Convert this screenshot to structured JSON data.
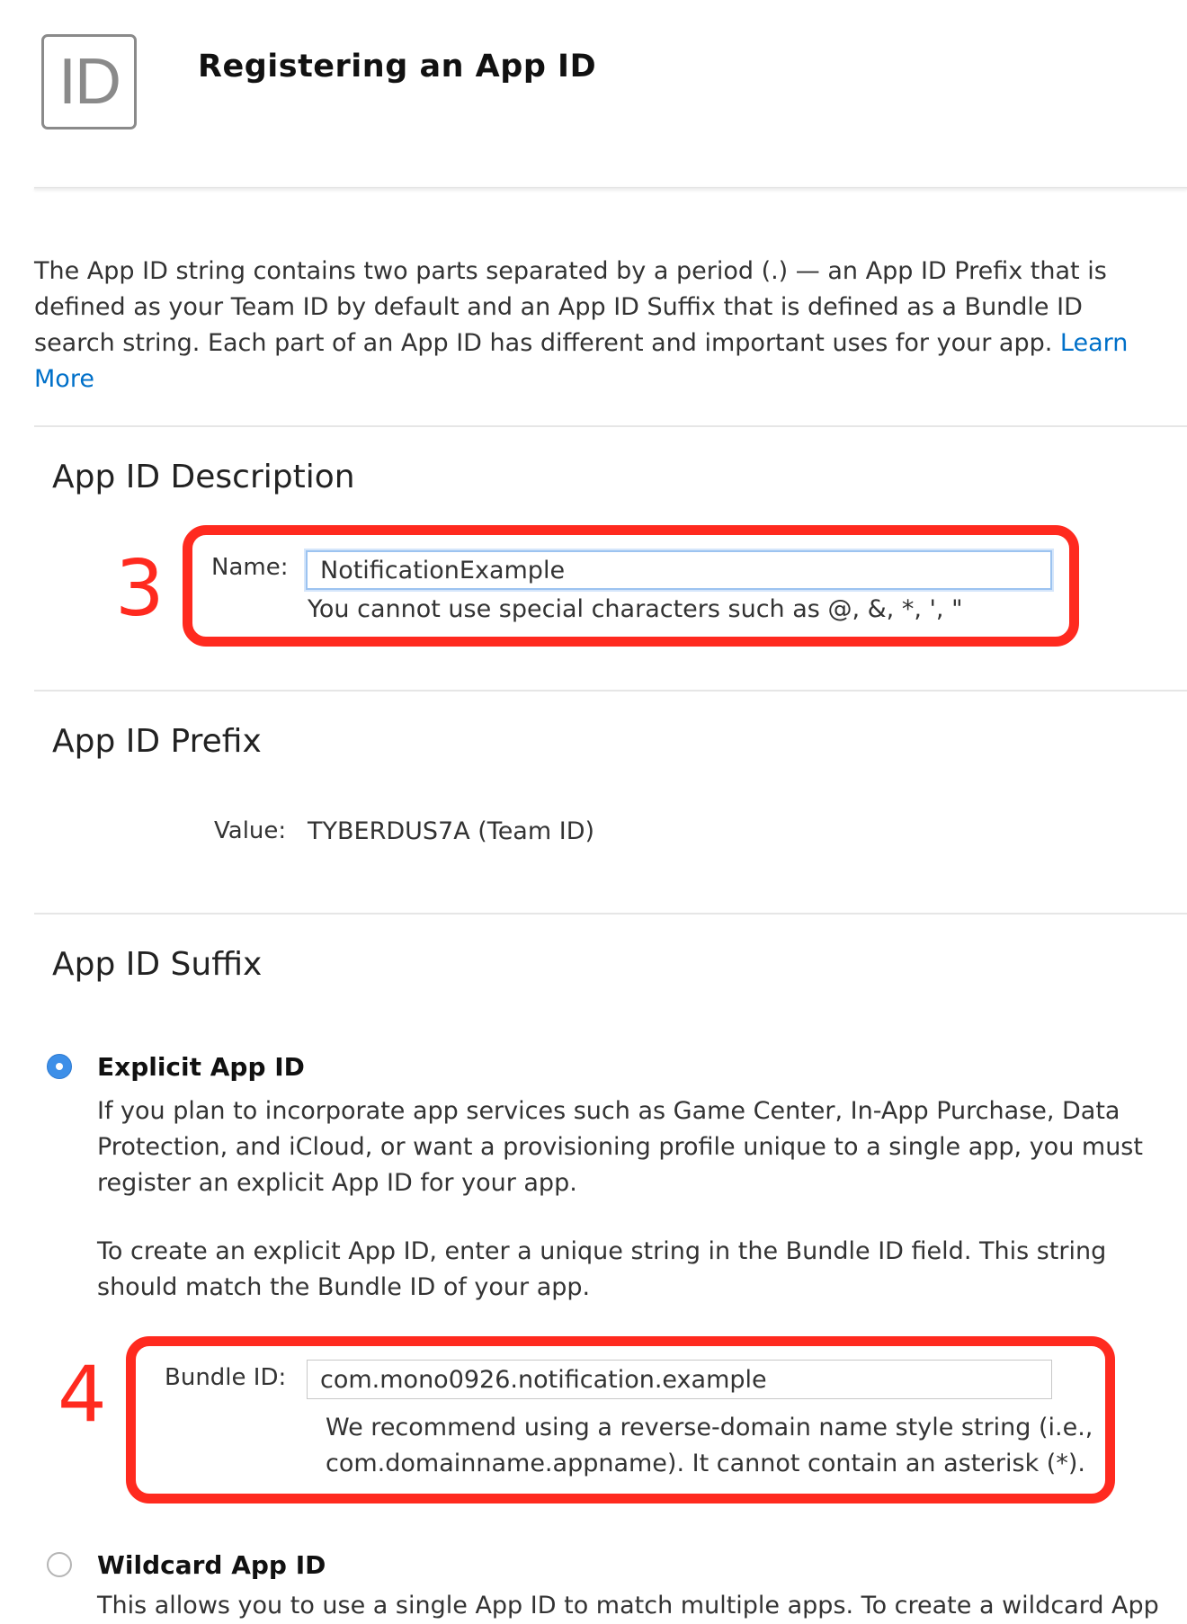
{
  "header": {
    "icon_text": "ID",
    "title": "Registering an App ID"
  },
  "intro": {
    "text": "The App ID string contains two parts separated by a period (.) — an App ID Prefix that is defined as your Team ID by default and an App ID Suffix that is defined as a Bundle ID search string. Each part of an App ID has different and important uses for your app.",
    "link_label": "Learn More"
  },
  "description_section": {
    "heading": "App ID Description",
    "name_label": "Name:",
    "name_value": "NotificationExample",
    "name_helper": "You cannot use special characters such as @, &, *, ', \""
  },
  "prefix_section": {
    "heading": "App ID Prefix",
    "value_label": "Value:",
    "value": "TYBERDUS7A (Team ID)"
  },
  "suffix_section": {
    "heading": "App ID Suffix",
    "explicit": {
      "title": "Explicit App ID",
      "selected": true,
      "paragraph1": "If you plan to incorporate app services such as Game Center, In-App Purchase, Data Protection, and iCloud, or want a provisioning profile unique to a single app, you must register an explicit App ID for your app.",
      "paragraph2": "To create an explicit App ID, enter a unique string in the Bundle ID field. This string should match the Bundle ID of your app.",
      "bundle_label": "Bundle ID:",
      "bundle_value": "com.mono0926.notification.example",
      "bundle_helper": "We recommend using a reverse-domain name style string (i.e., com.domainname.appname). It cannot contain an asterisk (*)."
    },
    "wildcard": {
      "title": "Wildcard App ID",
      "selected": false,
      "paragraph": "This allows you to use a single App ID to match multiple apps. To create a wildcard App"
    }
  },
  "annotations": {
    "step3": "3",
    "step4": "4"
  },
  "colors": {
    "annotation": "#ff2a1f",
    "link": "#0070c9",
    "radio_selected": "#3d8fe8"
  }
}
